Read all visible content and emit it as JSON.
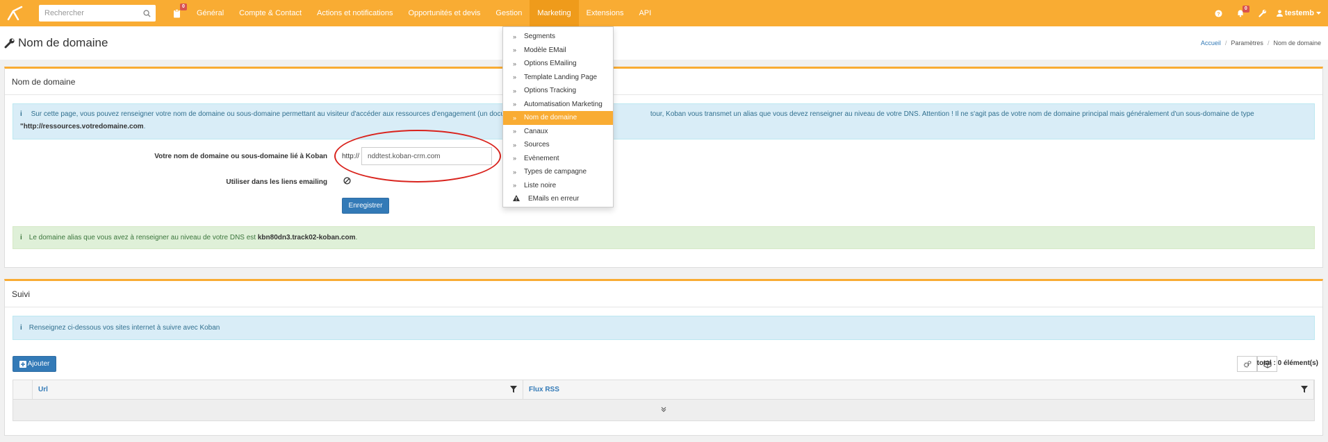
{
  "navbar": {
    "search_placeholder": "Rechercher",
    "tasks_badge": "0",
    "items": [
      {
        "label": "Général"
      },
      {
        "label": "Compte & Contact"
      },
      {
        "label": "Actions et notifications"
      },
      {
        "label": "Opportunités et devis"
      },
      {
        "label": "Gestion"
      },
      {
        "label": "Marketing"
      },
      {
        "label": "Extensions"
      },
      {
        "label": "API"
      }
    ],
    "notifications_badge": "0",
    "user": "testemb",
    "accent": "#f9ac33"
  },
  "page": {
    "title": "Nom de domaine",
    "breadcrumb": [
      "Accueil",
      "Paramètres",
      "Nom de domaine"
    ]
  },
  "domain_panel": {
    "heading": "Nom de domaine",
    "info_text_1": "Sur cette page, vous pouvez renseigner votre nom de domaine ou sous-domaine permettant au visiteur d'accéder aux ressources d'engagement (un docum",
    "info_text_2": "tour, Koban vous transmet un alias que vous devez renseigner au niveau de votre DNS. Attention ! Il ne s'agit pas de votre nom de domaine principal mais généralement d'un sous-domaine de type",
    "info_example": "\"http://ressources.votredomaine.com",
    "info_example_end": ".",
    "domain_label": "Votre nom de domaine ou sous-domaine lié à Koban",
    "domain_prefix": "http://",
    "domain_value": "nddtest.koban-crm.com",
    "emailing_label": "Utiliser dans les liens emailing",
    "save_button": "Enregistrer",
    "alias_text": "Le domaine alias que vous avez à renseigner au niveau de votre DNS est",
    "alias_value": "kbn80dn3.track02-koban.com",
    "alias_end": "."
  },
  "tracking_panel": {
    "heading": "Suivi",
    "info_text": "Renseignez ci-dessous vos sites internet à suivre avec Koban",
    "add_button": "Ajouter",
    "total": "total : 0 élément(s)",
    "columns": [
      "Url",
      "Flux RSS"
    ]
  },
  "marketing_menu": {
    "items": [
      {
        "label": "Segments"
      },
      {
        "label": "Modèle EMail"
      },
      {
        "label": "Options EMailing"
      },
      {
        "label": "Template Landing Page"
      },
      {
        "label": "Options Tracking"
      },
      {
        "label": "Automatisation Marketing"
      },
      {
        "label": "Nom de domaine"
      },
      {
        "label": "Canaux"
      },
      {
        "label": "Sources"
      },
      {
        "label": "Evènement"
      },
      {
        "label": "Types de campagne"
      },
      {
        "label": "Liste noire"
      },
      {
        "label": "EMails en erreur"
      }
    ]
  }
}
